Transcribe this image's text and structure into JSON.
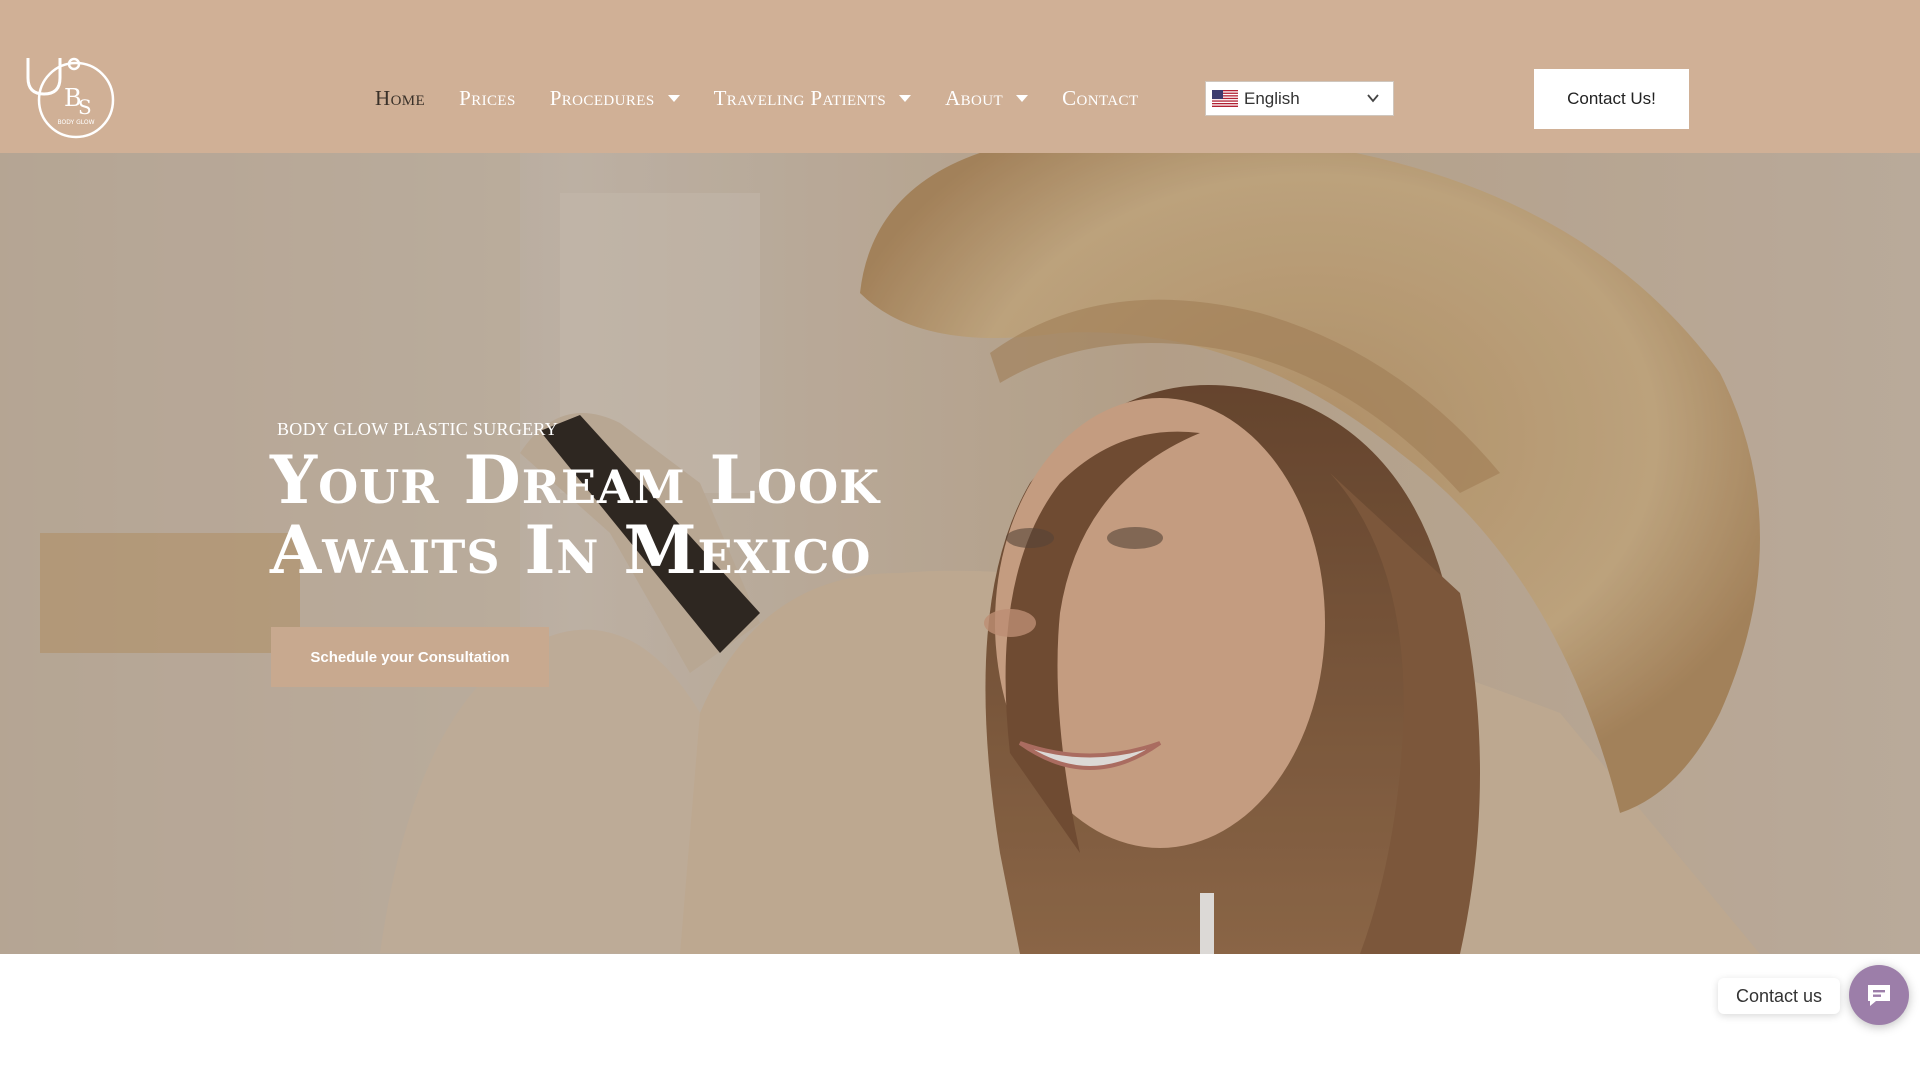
{
  "header": {
    "logo_icon": "stethoscope-logo-icon",
    "logo_text": "BODY GLOW",
    "nav": [
      {
        "label": "Home",
        "active": true,
        "dropdown": false
      },
      {
        "label": "Prices",
        "active": false,
        "dropdown": false
      },
      {
        "label": "Procedures",
        "active": false,
        "dropdown": true
      },
      {
        "label": "Traveling Patients",
        "active": false,
        "dropdown": true
      },
      {
        "label": "About",
        "active": false,
        "dropdown": true
      },
      {
        "label": "Contact",
        "active": false,
        "dropdown": false
      }
    ],
    "language": {
      "selected": "English",
      "flag_icon": "us-flag-icon",
      "chevron_icon": "chevron-down-icon"
    },
    "contact_button": "Contact Us!"
  },
  "hero": {
    "eyebrow": "BODY GLOW PLASTIC SURGERY",
    "title_line1": "Your Dream Look",
    "title_line2": "Awaits In Mexico",
    "cta": "Schedule your Consultation",
    "image": "woman-in-straw-hat-photo"
  },
  "chat": {
    "label": "Contact us",
    "icon": "chat-bubble-icon"
  },
  "colors": {
    "header_bg": "#d0b096",
    "active_nav": "#3a3129",
    "cta_bg": "#c8a98f",
    "chat_bg": "#9c7ea9"
  }
}
